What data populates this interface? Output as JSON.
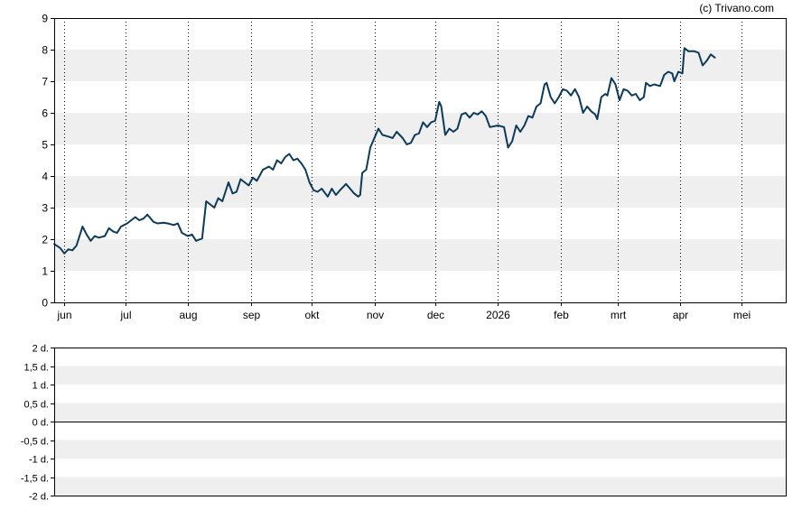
{
  "watermark": "(c) Trivano.com",
  "colors": {
    "line": "#0d3a58",
    "band": "#efefef",
    "frame": "#000000",
    "grid": "#000000"
  },
  "chart_data": [
    {
      "type": "line",
      "title": "",
      "xlabel": "",
      "ylabel": "",
      "ylim": [
        0,
        9
      ],
      "y_ticks": [
        "0",
        "1",
        "2",
        "3",
        "4",
        "5",
        "6",
        "7",
        "8",
        "9"
      ],
      "x_ticks": [
        {
          "label": "jun",
          "day": 5
        },
        {
          "label": "jul",
          "day": 35
        },
        {
          "label": "aug",
          "day": 66
        },
        {
          "label": "sep",
          "day": 97
        },
        {
          "label": "okt",
          "day": 127
        },
        {
          "label": "nov",
          "day": 158
        },
        {
          "label": "dec",
          "day": 188
        },
        {
          "label": "2026",
          "day": 219
        },
        {
          "label": "feb",
          "day": 250
        },
        {
          "label": "mrt",
          "day": 278
        },
        {
          "label": "apr",
          "day": 309
        },
        {
          "label": "mei",
          "day": 339
        }
      ],
      "x_range_days": [
        0,
        361
      ],
      "grid": "dotted vertical at month ticks, alternating horizontal bands",
      "series": [
        {
          "points": [
            [
              0,
              1.85
            ],
            [
              3,
              1.72
            ],
            [
              5,
              1.55
            ],
            [
              7,
              1.68
            ],
            [
              9,
              1.65
            ],
            [
              11,
              1.8
            ],
            [
              14,
              2.4
            ],
            [
              16,
              2.15
            ],
            [
              18,
              1.95
            ],
            [
              20,
              2.1
            ],
            [
              22,
              2.05
            ],
            [
              25,
              2.1
            ],
            [
              27,
              2.35
            ],
            [
              29,
              2.25
            ],
            [
              31,
              2.2
            ],
            [
              33,
              2.4
            ],
            [
              36,
              2.5
            ],
            [
              38,
              2.6
            ],
            [
              40,
              2.7
            ],
            [
              42,
              2.6
            ],
            [
              44,
              2.65
            ],
            [
              46,
              2.78
            ],
            [
              49,
              2.55
            ],
            [
              51,
              2.5
            ],
            [
              54,
              2.52
            ],
            [
              56,
              2.5
            ],
            [
              59,
              2.45
            ],
            [
              61,
              2.5
            ],
            [
              63,
              2.2
            ],
            [
              66,
              2.1
            ],
            [
              68,
              2.15
            ],
            [
              70,
              1.95
            ],
            [
              72,
              2.0
            ],
            [
              73,
              2.02
            ],
            [
              75,
              3.2
            ],
            [
              77,
              3.1
            ],
            [
              79,
              3.0
            ],
            [
              81,
              3.3
            ],
            [
              83,
              3.2
            ],
            [
              86,
              3.8
            ],
            [
              88,
              3.45
            ],
            [
              90,
              3.5
            ],
            [
              92,
              3.9
            ],
            [
              94,
              3.8
            ],
            [
              96,
              3.7
            ],
            [
              98,
              3.95
            ],
            [
              100,
              3.85
            ],
            [
              103,
              4.2
            ],
            [
              106,
              4.3
            ],
            [
              108,
              4.2
            ],
            [
              110,
              4.5
            ],
            [
              112,
              4.4
            ],
            [
              114,
              4.6
            ],
            [
              116,
              4.7
            ],
            [
              118,
              4.5
            ],
            [
              120,
              4.55
            ],
            [
              122,
              4.4
            ],
            [
              124,
              4.2
            ],
            [
              126,
              3.8
            ],
            [
              128,
              3.55
            ],
            [
              130,
              3.5
            ],
            [
              132,
              3.6
            ],
            [
              135,
              3.35
            ],
            [
              137,
              3.6
            ],
            [
              139,
              3.4
            ],
            [
              141,
              3.55
            ],
            [
              144,
              3.75
            ],
            [
              146,
              3.6
            ],
            [
              148,
              3.45
            ],
            [
              150,
              3.35
            ],
            [
              151,
              3.4
            ],
            [
              152,
              4.1
            ],
            [
              154,
              4.2
            ],
            [
              156,
              4.9
            ],
            [
              158,
              5.2
            ],
            [
              160,
              5.5
            ],
            [
              162,
              5.3
            ],
            [
              165,
              5.25
            ],
            [
              167,
              5.2
            ],
            [
              169,
              5.4
            ],
            [
              172,
              5.2
            ],
            [
              174,
              5.0
            ],
            [
              176,
              5.05
            ],
            [
              178,
              5.3
            ],
            [
              180,
              5.35
            ],
            [
              182,
              5.7
            ],
            [
              184,
              5.55
            ],
            [
              186,
              5.7
            ],
            [
              188,
              5.75
            ],
            [
              190,
              6.35
            ],
            [
              191,
              6.2
            ],
            [
              193,
              5.3
            ],
            [
              195,
              5.5
            ],
            [
              197,
              5.4
            ],
            [
              199,
              5.5
            ],
            [
              201,
              5.95
            ],
            [
              203,
              6.0
            ],
            [
              205,
              5.85
            ],
            [
              207,
              6.0
            ],
            [
              209,
              5.95
            ],
            [
              211,
              6.05
            ],
            [
              213,
              5.9
            ],
            [
              215,
              5.55
            ],
            [
              219,
              5.6
            ],
            [
              222,
              5.55
            ],
            [
              224,
              4.9
            ],
            [
              226,
              5.1
            ],
            [
              228,
              5.6
            ],
            [
              230,
              5.4
            ],
            [
              232,
              5.6
            ],
            [
              234,
              5.9
            ],
            [
              236,
              5.85
            ],
            [
              238,
              6.2
            ],
            [
              240,
              6.3
            ],
            [
              242,
              6.9
            ],
            [
              243,
              6.95
            ],
            [
              245,
              6.5
            ],
            [
              247,
              6.3
            ],
            [
              249,
              6.5
            ],
            [
              251,
              6.75
            ],
            [
              253,
              6.7
            ],
            [
              255,
              6.55
            ],
            [
              257,
              6.75
            ],
            [
              259,
              6.5
            ],
            [
              261,
              6.0
            ],
            [
              263,
              6.2
            ],
            [
              265,
              6.05
            ],
            [
              267,
              5.95
            ],
            [
              268,
              5.8
            ],
            [
              270,
              6.5
            ],
            [
              272,
              6.6
            ],
            [
              273,
              6.55
            ],
            [
              275,
              7.1
            ],
            [
              277,
              6.9
            ],
            [
              279,
              6.4
            ],
            [
              281,
              6.75
            ],
            [
              283,
              6.7
            ],
            [
              285,
              6.55
            ],
            [
              287,
              6.6
            ],
            [
              289,
              6.4
            ],
            [
              291,
              6.5
            ],
            [
              292,
              6.95
            ],
            [
              294,
              6.85
            ],
            [
              296,
              6.9
            ],
            [
              299,
              6.85
            ],
            [
              301,
              7.2
            ],
            [
              303,
              7.3
            ],
            [
              305,
              7.25
            ],
            [
              306,
              7.0
            ],
            [
              308,
              7.3
            ],
            [
              310,
              7.25
            ],
            [
              311,
              8.05
            ],
            [
              313,
              7.95
            ],
            [
              316,
              7.95
            ],
            [
              318,
              7.9
            ],
            [
              320,
              7.5
            ],
            [
              322,
              7.65
            ],
            [
              324,
              7.85
            ],
            [
              326,
              7.75
            ]
          ]
        }
      ]
    },
    {
      "type": "bar",
      "title": "",
      "xlabel": "",
      "ylabel": "",
      "ylim": [
        -2,
        2
      ],
      "y_ticks": [
        "2 d.",
        "1,5 d.",
        "1 d.",
        "0,5 d.",
        "0 d.",
        "-0,5 d.",
        "-1 d.",
        "-1,5 d.",
        "-2 d."
      ],
      "values": []
    }
  ]
}
